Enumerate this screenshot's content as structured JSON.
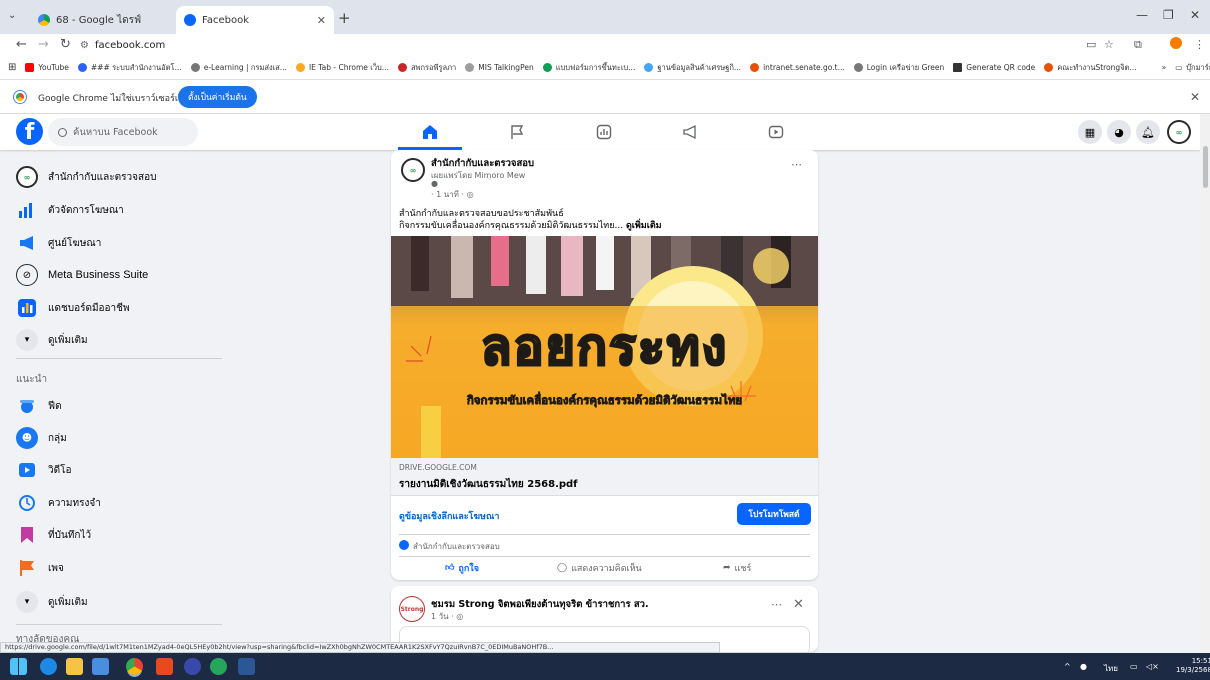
{
  "browser": {
    "tabs": [
      {
        "title": "68 - Google ไดรฟ์",
        "active": false
      },
      {
        "title": "Facebook",
        "active": true
      }
    ],
    "url": "facebook.com",
    "bookmarks": [
      "YouTube",
      "### ระบบสำนักงานอัตโ...",
      "e-Learning | กรมส่งเส...",
      "IE Tab - Chrome เว็บ...",
      "สพกรอพีรูลภา",
      "MIS TalkingPen",
      "แบบฟอร์มการขึ้นทะเบ...",
      "ฐานข้อมูลสินค้าเศรษฐกิ...",
      "intranet.senate.go.t...",
      "Login เครือข่าย Green",
      "Generate QR code",
      "คณะทำงานStrongจิต..."
    ],
    "bookmarks_more": "»",
    "all_bookmarks": "บุ๊กมาร์กทั้งหมด",
    "infobar_text": "Google Chrome ไม่ใช่เบราว์เซอร์เริ่มต้น",
    "infobar_button": "ตั้งเป็นค่าเริ่มต้น",
    "status_url": "https://drive.google.com/file/d/1wlt7M1ten1MZyad4-0eQL5HEy0b2ht/view?usp=sharing&fbclid=IwZXh0bgNhZW0CMTEAAR1K2SXFvY7QzuIRvnB7C_0EDIMuBaNOHf7B..."
  },
  "facebook": {
    "search_placeholder": "ค้นหาบน Facebook",
    "sidebar": {
      "items": [
        {
          "label": "สำนักกำกับและตรวจสอบ",
          "icon": "page-avatar-icon"
        },
        {
          "label": "ตัวจัดการโฆษณา",
          "icon": "ads-manager-icon"
        },
        {
          "label": "ศูนย์โฆษณา",
          "icon": "megaphone-icon"
        },
        {
          "label": "Meta Business Suite",
          "icon": "meta-business-icon"
        },
        {
          "label": "แดชบอร์ดมืออาชีพ",
          "icon": "dashboard-icon"
        },
        {
          "label": "ดูเพิ่มเติม",
          "icon": "chevron-down-icon"
        }
      ],
      "suggest_header": "แนะนำ",
      "suggest_items": [
        {
          "label": "ฟีด",
          "icon": "feed-icon"
        },
        {
          "label": "กลุ่ม",
          "icon": "groups-icon"
        },
        {
          "label": "วิดีโอ",
          "icon": "video-icon"
        },
        {
          "label": "ความทรงจำ",
          "icon": "memories-icon"
        },
        {
          "label": "ที่บันทึกไว้",
          "icon": "saved-icon"
        },
        {
          "label": "เพจ",
          "icon": "pages-icon"
        },
        {
          "label": "ดูเพิ่มเติม",
          "icon": "chevron-down-icon"
        }
      ],
      "shortcuts_header": "ทางลัดของคุณ"
    },
    "post1": {
      "author": "สำนักกำกับและตรวจสอบ",
      "posted_by": "เผยแพร่โดย Mimoro Mew",
      "time": "· 1 นาที ·",
      "text_line1": "สำนักกำกับและตรวจสอบขอประชาสัมพันธ์",
      "text_line2": "กิจกรรมขับเคลื่อนองค์กรคุณธรรมด้วยมิติวัฒนธรรมไทย...",
      "see_more": "ดูเพิ่มเติม",
      "image_title": "ลอยกระทง",
      "image_subtitle": "กิจกรรมขับเคลื่อนองค์กรคุณธรรมด้วยมิติวัฒนธรรมไทย",
      "link_domain": "DRIVE.GOOGLE.COM",
      "link_title": "รายงานมิติเชิงวัฒนธรรมไทย 2568.pdf",
      "insights_link": "ดูข้อมูลเชิงลึกและโฆษณา",
      "promote_button": "โปรโมทโพสต์",
      "reaction_name": "สำนักกำกับและตรวจสอบ",
      "like": "ถูกใจ",
      "comment": "แสดงความคิดเห็น",
      "share": "แชร์"
    },
    "post2": {
      "author": "ชมรม Strong จิตพอเพียงต้านทุจริต ข้าราชการ สว.",
      "time": "1 วัน ·"
    }
  },
  "taskbar": {
    "lang": "ไทย",
    "time": "15:51",
    "date": "19/3/2568"
  },
  "colors": {
    "facebook_blue": "#0866ff",
    "chrome_blue": "#1a73e8",
    "taskbar": "#1c2a44"
  }
}
